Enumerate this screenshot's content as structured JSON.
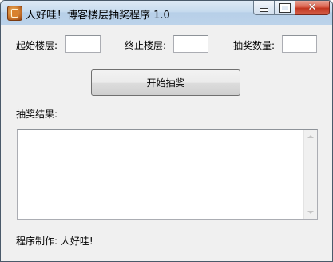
{
  "window": {
    "title": "人好哇！博客楼层抽奖程序 1.0"
  },
  "form": {
    "start_floor_label": "起始楼层:",
    "start_floor_value": "",
    "end_floor_label": "终止楼层:",
    "end_floor_value": "",
    "prize_count_label": "抽奖数量:",
    "prize_count_value": ""
  },
  "actions": {
    "start_button_label": "开始抽奖"
  },
  "results": {
    "label": "抽奖结果:",
    "content": ""
  },
  "footer": {
    "credit": "程序制作: 人好哇!"
  },
  "icons": {
    "app": "app-icon",
    "minimize": "minimize-icon",
    "maximize": "maximize-icon",
    "close": "close-icon"
  }
}
